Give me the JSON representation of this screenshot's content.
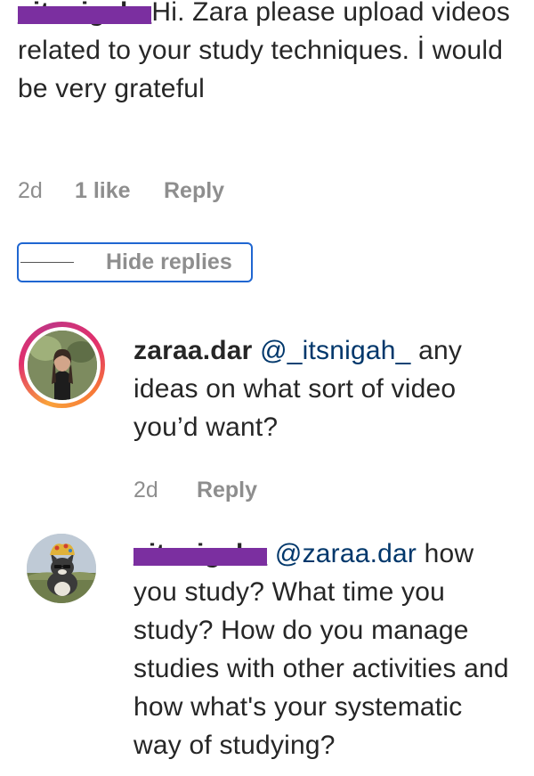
{
  "comment": {
    "username": "_itsnigah_",
    "text": "Hi. Zara please upload videos related to your study techniques. İ would be very grateful",
    "time": "2d",
    "likes": "1 like",
    "reply_label": "Reply"
  },
  "hide_replies_label": "Hide replies",
  "replies": [
    {
      "username": "zaraa.dar",
      "mention": "@_itsnigah_",
      "text": " any ideas on what sort of video you’d want?",
      "time": "2d",
      "reply_label": "Reply"
    },
    {
      "username": "_itsnigah_",
      "mention": "@zaraa.dar",
      "text": "how you study? What time you study? How do you manage studies with other activities and how what's your systematic way of studying?"
    }
  ],
  "colors": {
    "redaction": "#7b2fa0",
    "focus_border": "#1f66d1",
    "meta_gray": "#8e8e8e",
    "mention_blue": "#00376b"
  }
}
